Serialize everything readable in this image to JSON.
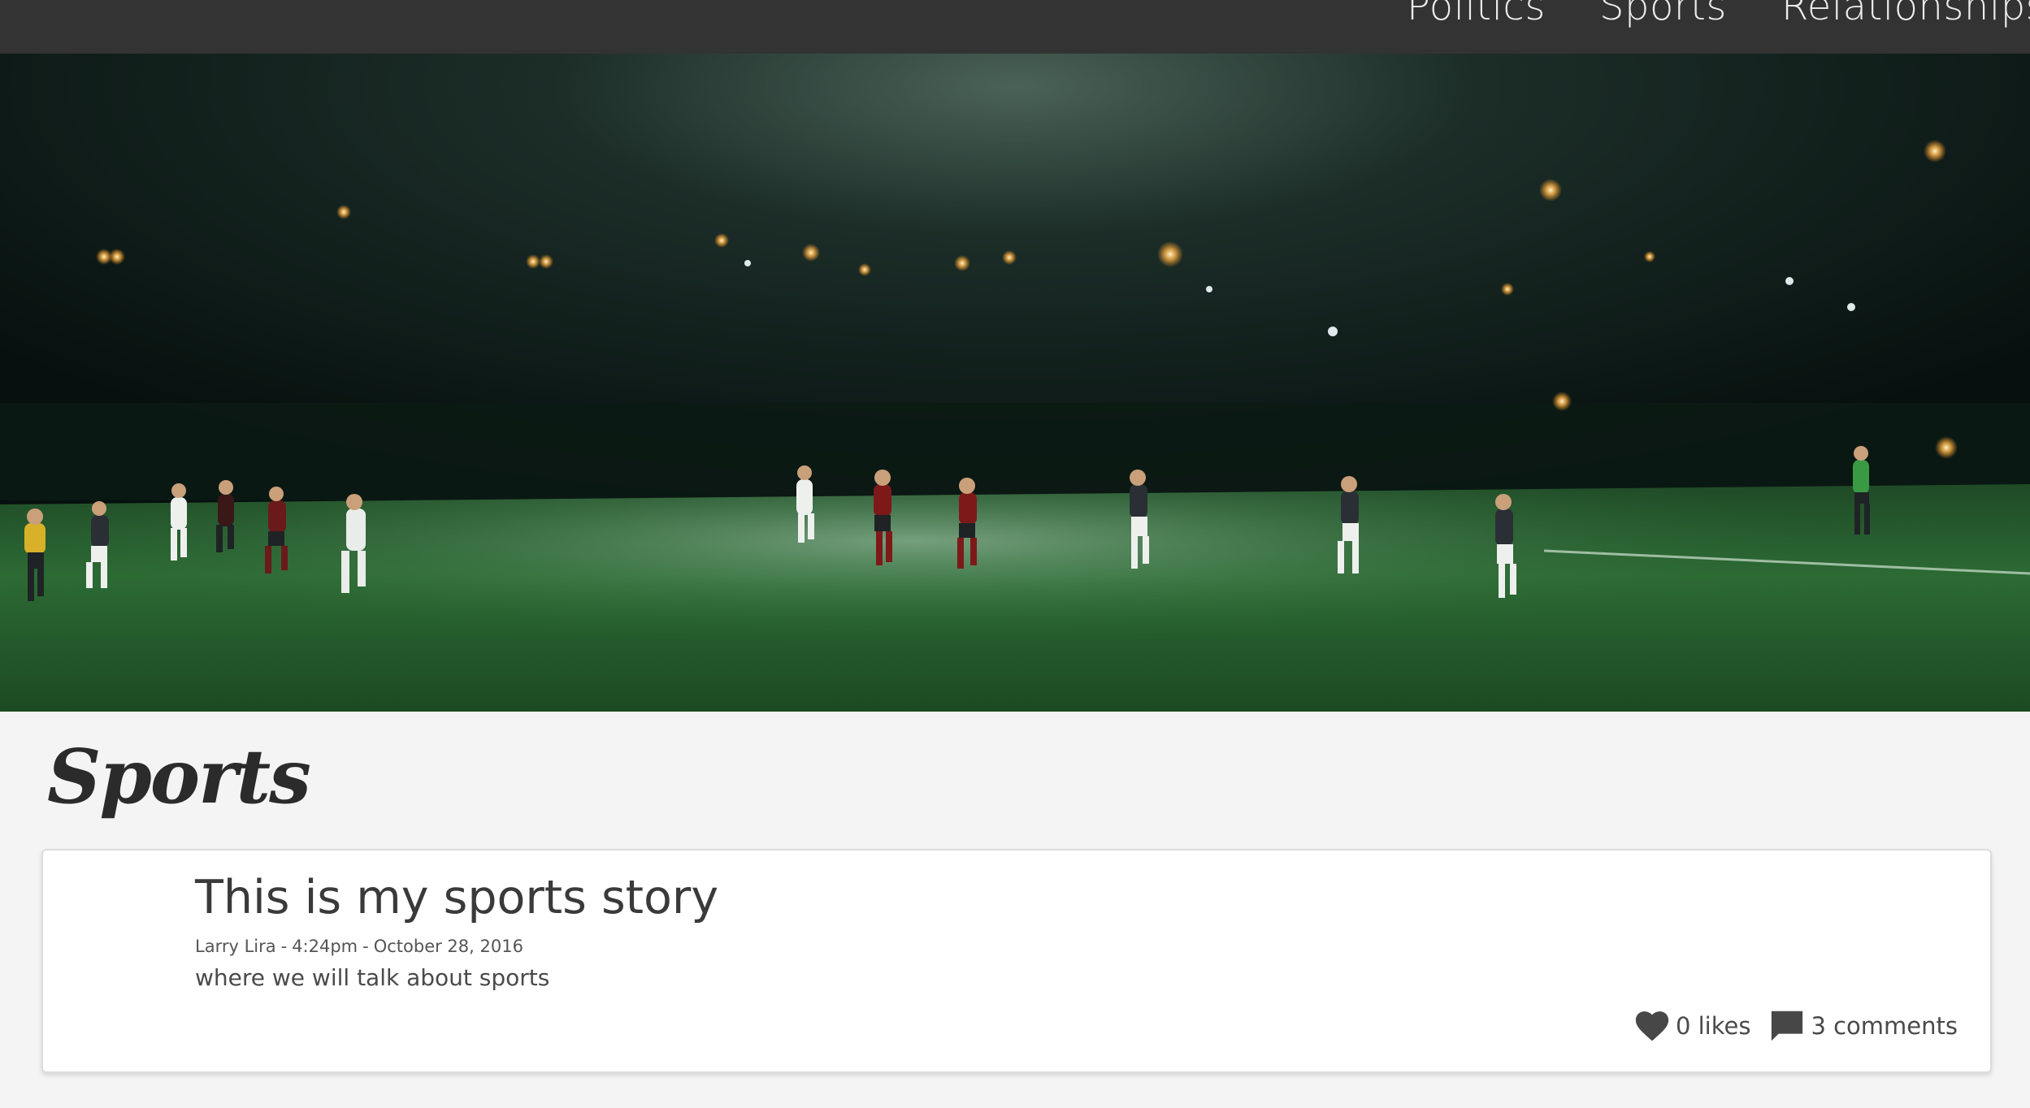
{
  "nav": {
    "items": [
      {
        "label": "Politics"
      },
      {
        "label": "Sports"
      },
      {
        "label": "Relationships"
      }
    ]
  },
  "hero": {
    "image": "night-soccer-match-photo"
  },
  "section": {
    "heading": "Sports"
  },
  "post": {
    "title": "This is my sports story",
    "author": "Larry Lira",
    "separator": "-",
    "time": "4:24pm",
    "date_sep": "-",
    "date": "October 28, 2016",
    "body": "where we will talk about sports",
    "likes_label": "0 likes",
    "comments_label": "3 comments",
    "icons": {
      "likes": "heart-icon",
      "comments": "comment-bubble-icon"
    }
  },
  "colors": {
    "nav_bg": "#333333",
    "page_bg": "#f4f4f4",
    "card_bg": "#ffffff",
    "text": "#3a3a3a"
  }
}
